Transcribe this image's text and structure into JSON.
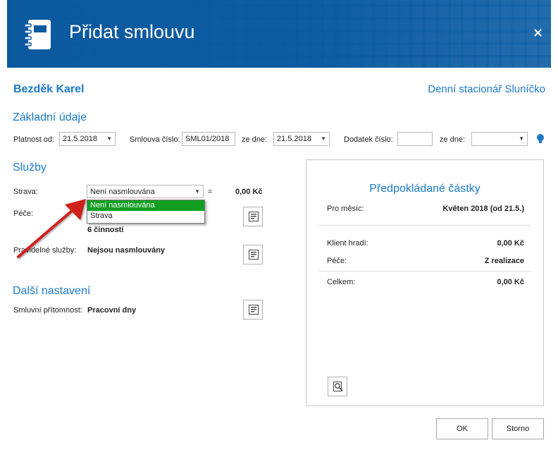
{
  "window": {
    "title": "Přidat smlouvu",
    "close_symbol": "×"
  },
  "client": {
    "name": "Bezděk Karel",
    "facility": "Denní stacionář Sluníčko"
  },
  "basic": {
    "section_title": "Základní údaje",
    "valid_from_label": "Platnost od:",
    "valid_from_value": "21.5.2018",
    "contract_no_label": "Smlouva číslo:",
    "contract_no_value": "SML01/2018",
    "from_date_label": "ze dne:",
    "from_date_value": "21.5.2018",
    "addendum_label": "Dodatek číslo:",
    "addendum_value": "",
    "addendum_date_label": "ze dne:",
    "addendum_date_value": ""
  },
  "services": {
    "section_title": "Služby",
    "meal_label": "Strava:",
    "meal_selected": "Není nasmlouvána",
    "meal_equals": "=",
    "meal_amount": "0,00 Kč",
    "meal_options": [
      "Není nasmlouvána",
      "Strava"
    ],
    "care_label": "Péče:",
    "care_value": "6 činností",
    "regular_label": "Pravidelné služby:",
    "regular_value": "Nejsou nasmlouvány"
  },
  "other": {
    "section_title": "Další nastavení",
    "presence_label": "Smluvní přítomnost:",
    "presence_value": "Pracovní dny"
  },
  "estimate": {
    "title": "Předpokládané částky",
    "month_label": "Pro měsíc:",
    "month_value": "Květen 2018 (od 21.5.)",
    "client_pays_label": "Klient hradí:",
    "client_pays_value": "0,00 Kč",
    "care_label": "Péče:",
    "care_value": "Z realizace",
    "total_label": "Celkem:",
    "total_value": "0,00 Kč"
  },
  "buttons": {
    "ok": "OK",
    "cancel": "Storno"
  },
  "colors": {
    "header": "#0b5aa0",
    "accent": "#1a7ac7",
    "selection": "#119e21",
    "arrow": "#d0211d"
  }
}
